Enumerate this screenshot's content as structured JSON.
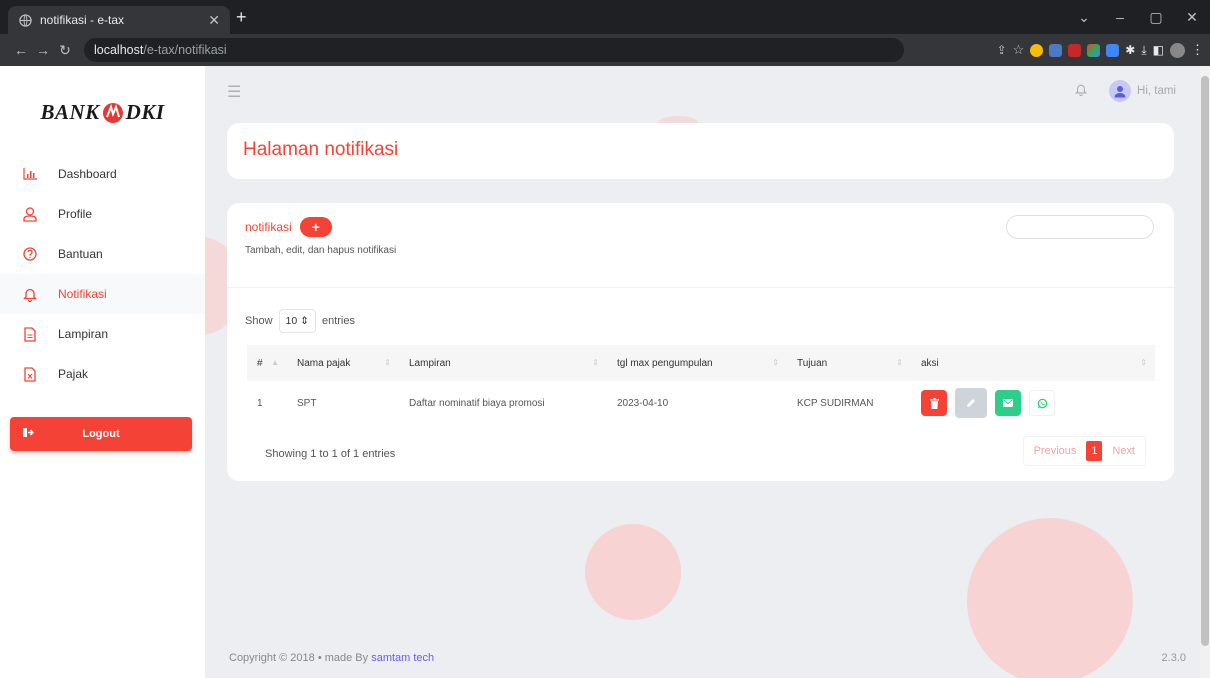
{
  "browser": {
    "tab_title": "notifikasi - e-tax",
    "url_host": "localhost",
    "url_path": "/e-tax/notifikasi"
  },
  "sidebar": {
    "logo_left": "BANK",
    "logo_right": "DKI",
    "items": [
      {
        "label": "Dashboard",
        "icon": "chart-icon"
      },
      {
        "label": "Profile",
        "icon": "user-icon"
      },
      {
        "label": "Bantuan",
        "icon": "help-icon"
      },
      {
        "label": "Notifikasi",
        "icon": "bell-icon",
        "active": true
      },
      {
        "label": "Lampiran",
        "icon": "document-icon"
      },
      {
        "label": "Pajak",
        "icon": "excel-file-icon"
      }
    ],
    "logout_label": "Logout"
  },
  "header": {
    "greeting": "Hi, tami"
  },
  "page": {
    "title": "Halaman notifikasi",
    "section_title": "notifikasi",
    "section_subtitle": "Tambah, edit, dan hapus notifikasi",
    "show_label": "Show",
    "page_length": "10",
    "entries_label": "entries",
    "columns": [
      "#",
      "Nama pajak",
      "Lampiran",
      "tgl max pengumpulan",
      "Tujuan",
      "aksi"
    ],
    "rows": [
      {
        "no": "1",
        "nama_pajak": "SPT",
        "lampiran": "Daftar nominatif biaya promosi",
        "tgl_max": "2023-04-10",
        "tujuan": "KCP SUDIRMAN"
      }
    ],
    "showing_info": "Showing 1 to 1 of 1 entries",
    "pager": {
      "previous": "Previous",
      "current": "1",
      "next": "Next"
    }
  },
  "footer": {
    "copyright": "Copyright © 2018 • made By ",
    "brand": "samtam tech",
    "version": "2.3.0"
  },
  "colors": {
    "accent": "#f44336",
    "link": "#6b5bf0",
    "edit": "#ced4da",
    "mail": "#2dce89",
    "whatsapp": "#25d366"
  }
}
